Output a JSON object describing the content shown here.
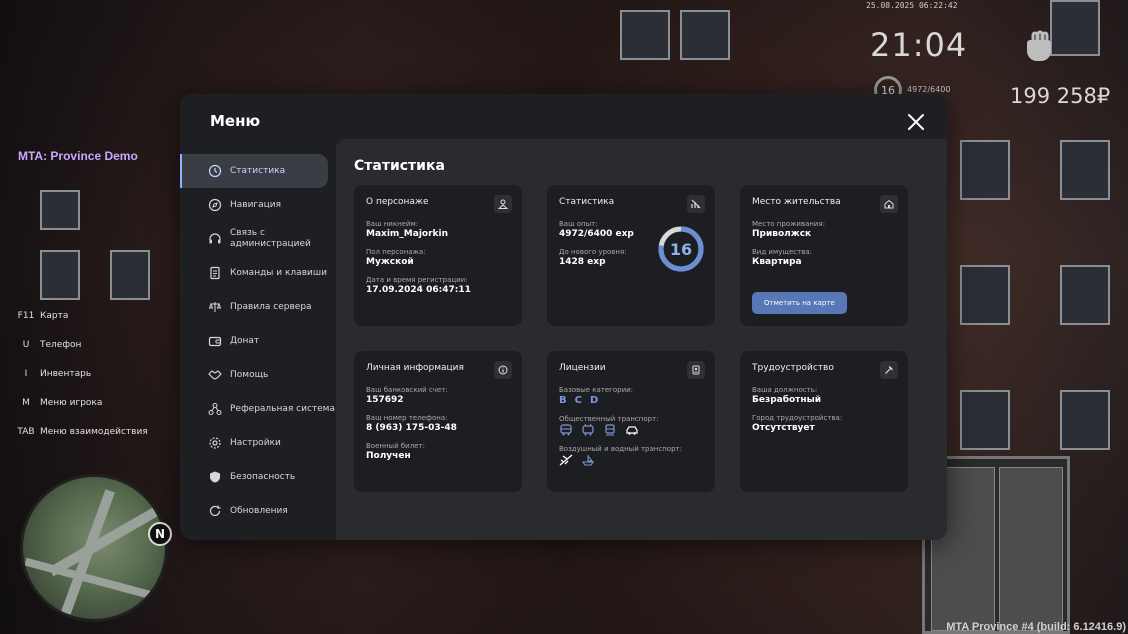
{
  "hud": {
    "datetime": "25.08.2025 06:22:42",
    "time": "21:04",
    "level": "16",
    "exp": "4972/6400",
    "money": "199 258₽",
    "server": "MTA: Province Demo",
    "build": "MTA Province #4 (build: 6.12416.9)",
    "compass": "N"
  },
  "hotkeys": [
    {
      "key": "F11",
      "label": "Карта"
    },
    {
      "key": "U",
      "label": "Телефон"
    },
    {
      "key": "I",
      "label": "Инвентарь"
    },
    {
      "key": "M",
      "label": "Меню игрока"
    },
    {
      "key": "TAB",
      "label": "Меню взаимодействия"
    }
  ],
  "menu": {
    "title": "Меню",
    "nav": [
      {
        "label": "Статистика",
        "icon": "clock-icon"
      },
      {
        "label": "Навигация",
        "icon": "compass-icon"
      },
      {
        "label": "Связь с администрацией",
        "icon": "headset-icon"
      },
      {
        "label": "Команды и клавиши",
        "icon": "document-icon"
      },
      {
        "label": "Правила сервера",
        "icon": "scales-icon"
      },
      {
        "label": "Донат",
        "icon": "wallet-icon"
      },
      {
        "label": "Помощь",
        "icon": "handshake-icon"
      },
      {
        "label": "Реферальная система",
        "icon": "referral-icon"
      },
      {
        "label": "Настройки",
        "icon": "gear-icon"
      },
      {
        "label": "Безопасность",
        "icon": "shield-icon"
      },
      {
        "label": "Обновления",
        "icon": "refresh-icon"
      }
    ]
  },
  "content": {
    "title": "Статистика",
    "character": {
      "title": "О персонаже",
      "nick_label": "Ваш никнейм:",
      "nick": "Maxim_Majorkin",
      "gender_label": "Пол персонажа:",
      "gender": "Мужской",
      "reg_label": "Дата и время регистрации:",
      "reg": "17.09.2024 06:47:11"
    },
    "stats": {
      "title": "Статистика",
      "exp_label": "Ваш опыт:",
      "exp": "4972/6400 exp",
      "next_label": "До нового уровня:",
      "next": "1428 exp",
      "level": "16",
      "progress": 0.777
    },
    "residence": {
      "title": "Место жительства",
      "place_label": "Место проживания:",
      "place": "Приволжск",
      "type_label": "Вид имущества:",
      "type": "Квартира",
      "button": "Отметить на карте"
    },
    "personal": {
      "title": "Личная информация",
      "bank_label": "Ваш банковский счет:",
      "bank": "157692",
      "phone_label": "Ваш номер телефона:",
      "phone": "8 (963) 175-03-48",
      "military_label": "Военный билет:",
      "military": "Получен"
    },
    "licenses": {
      "title": "Лицензии",
      "basic_label": "Базовые категории:",
      "categories": [
        "B",
        "C",
        "D"
      ],
      "public_label": "Общественный транспорт:",
      "air_label": "Воздушный и водный транспорт:"
    },
    "employment": {
      "title": "Трудоустройство",
      "position_label": "Ваша должность:",
      "position": "Безработный",
      "city_label": "Город трудоустройства:",
      "city": "Отсутствует"
    }
  },
  "colors": {
    "accent": "#5777b6",
    "ring": "#6b8fd6",
    "panel": "#1d1e21"
  }
}
